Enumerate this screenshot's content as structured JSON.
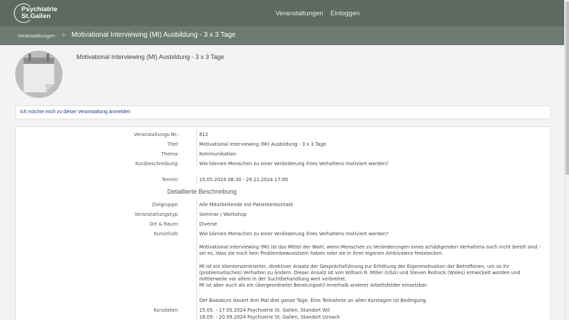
{
  "header": {
    "logo_line1": "Psychiatrie",
    "logo_line2": "St.Gallen",
    "nav": [
      "Veranstaltungen",
      "Einloggen"
    ]
  },
  "breadcrumb": {
    "link": "Veranstaltungen",
    "separator": "▷",
    "current": "Motivational Interviewing (MI) Ausbildung - 3 x 3 Tage"
  },
  "event": {
    "title": "Motivational Interviewing (MI) Ausbildung - 3 x 3 Tage",
    "register_link": "Ich möchte mich zu dieser Veranstaltung anmelden"
  },
  "details": {
    "nr_label": "Veranstaltungs-Nr.:",
    "nr": "812",
    "titel_label": "Titel:",
    "titel": "Motivational Interviewing (MI) Ausbildung - 3 x 3 Tage",
    "thema_label": "Thema:",
    "thema": "Kommunikation",
    "kurz_label": "Kurzbeschreibung:",
    "kurz": "Wie können Menschen zu einer Veränderung ihres Verhaltens motiviert werden?",
    "termin_label": "Termin:",
    "termin": "15.05.2024 08:30 - 29.11.2024 17:00",
    "section_title": "Detaillierte Beschreibung",
    "zielgruppe_label": "Zielgruppe:",
    "zielgruppe": "Alle Mitarbeitende mit Patientenkontakt",
    "typ_label": "Veranstaltungstyp:",
    "typ": "Seminar / Workshop",
    "ort_label": "Ort & Raum:",
    "ort": "Diverse",
    "inhalt_label": "Kursinhalt:",
    "inhalt_1": "Wie können Menschen zu einer Veränderung ihres Verhaltens motiviert werden?",
    "inhalt_2": "Motivational Interviewing (MI) ist das Mittel der Wahl, wenn Menschen zu Veränderungen eines schädigenden Verhaltens noch nicht bereit sind – sei es, dass sie noch kein Problembewusstsein haben oder sie in ihrer eigenen Ambivalenz feststecken.",
    "inhalt_3": "MI ist ein klientenzentrierter, direktiver Ansatz der Gesprächsführung zur Erhöhung der Eigenmotivation der Betroffenen, um so ihr (problematisches) Verhalten zu ändern. Dieser Ansatz ist von William R. Miller (USA) und Steven Rollnick (Wales) entwickelt worden und mittlerweile vor allem in der Suchtbehandlung weit verbreitet.",
    "inhalt_4": "MI ist aber auch als ein übergeordneter Beratungsstil innerhalb anderer Arbeitsfelder einsetzbar.",
    "inhalt_5": "Der Basiskurs dauert drei Mal drei ganze Tage. Eine Teilnahme an allen Kurstagen ist Bedingung.",
    "kursdaten_label": "Kursdaten:",
    "kursdaten": [
      "15.05. - 17.05.2024 Psychiatrie St. Gallen, Standort Wil",
      "18.09. - 20.09.2024 Psychiatrie St. Gallen, Standort Uznach"
    ]
  }
}
